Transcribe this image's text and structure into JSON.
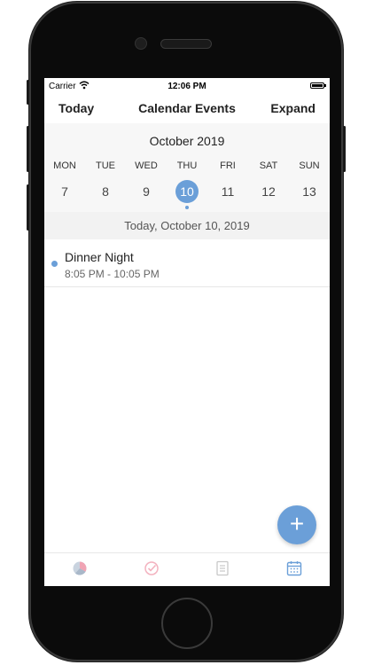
{
  "status_bar": {
    "carrier": "Carrier",
    "time": "12:06 PM"
  },
  "nav": {
    "left_button": "Today",
    "title": "Calendar Events",
    "right_button": "Expand"
  },
  "calendar": {
    "month": "October 2019",
    "weekdays": [
      "MON",
      "TUE",
      "WED",
      "THU",
      "FRI",
      "SAT",
      "SUN"
    ],
    "days": [
      "7",
      "8",
      "9",
      "10",
      "11",
      "12",
      "13"
    ],
    "selected_index": 3
  },
  "date_header": "Today, October 10, 2019",
  "events": [
    {
      "title": "Dinner Night",
      "time": "8:05 PM - 10:05 PM"
    }
  ],
  "fab": {
    "label": "+"
  },
  "tabs": [
    {
      "icon": "pie-chart-icon",
      "active": false
    },
    {
      "icon": "check-circle-icon",
      "active": false
    },
    {
      "icon": "document-icon",
      "active": false
    },
    {
      "icon": "calendar-icon",
      "active": true
    }
  ],
  "colors": {
    "accent": "#6b9fd8",
    "pie_accent": "#f0a4b4",
    "check_tint": "#f3b2bf"
  }
}
